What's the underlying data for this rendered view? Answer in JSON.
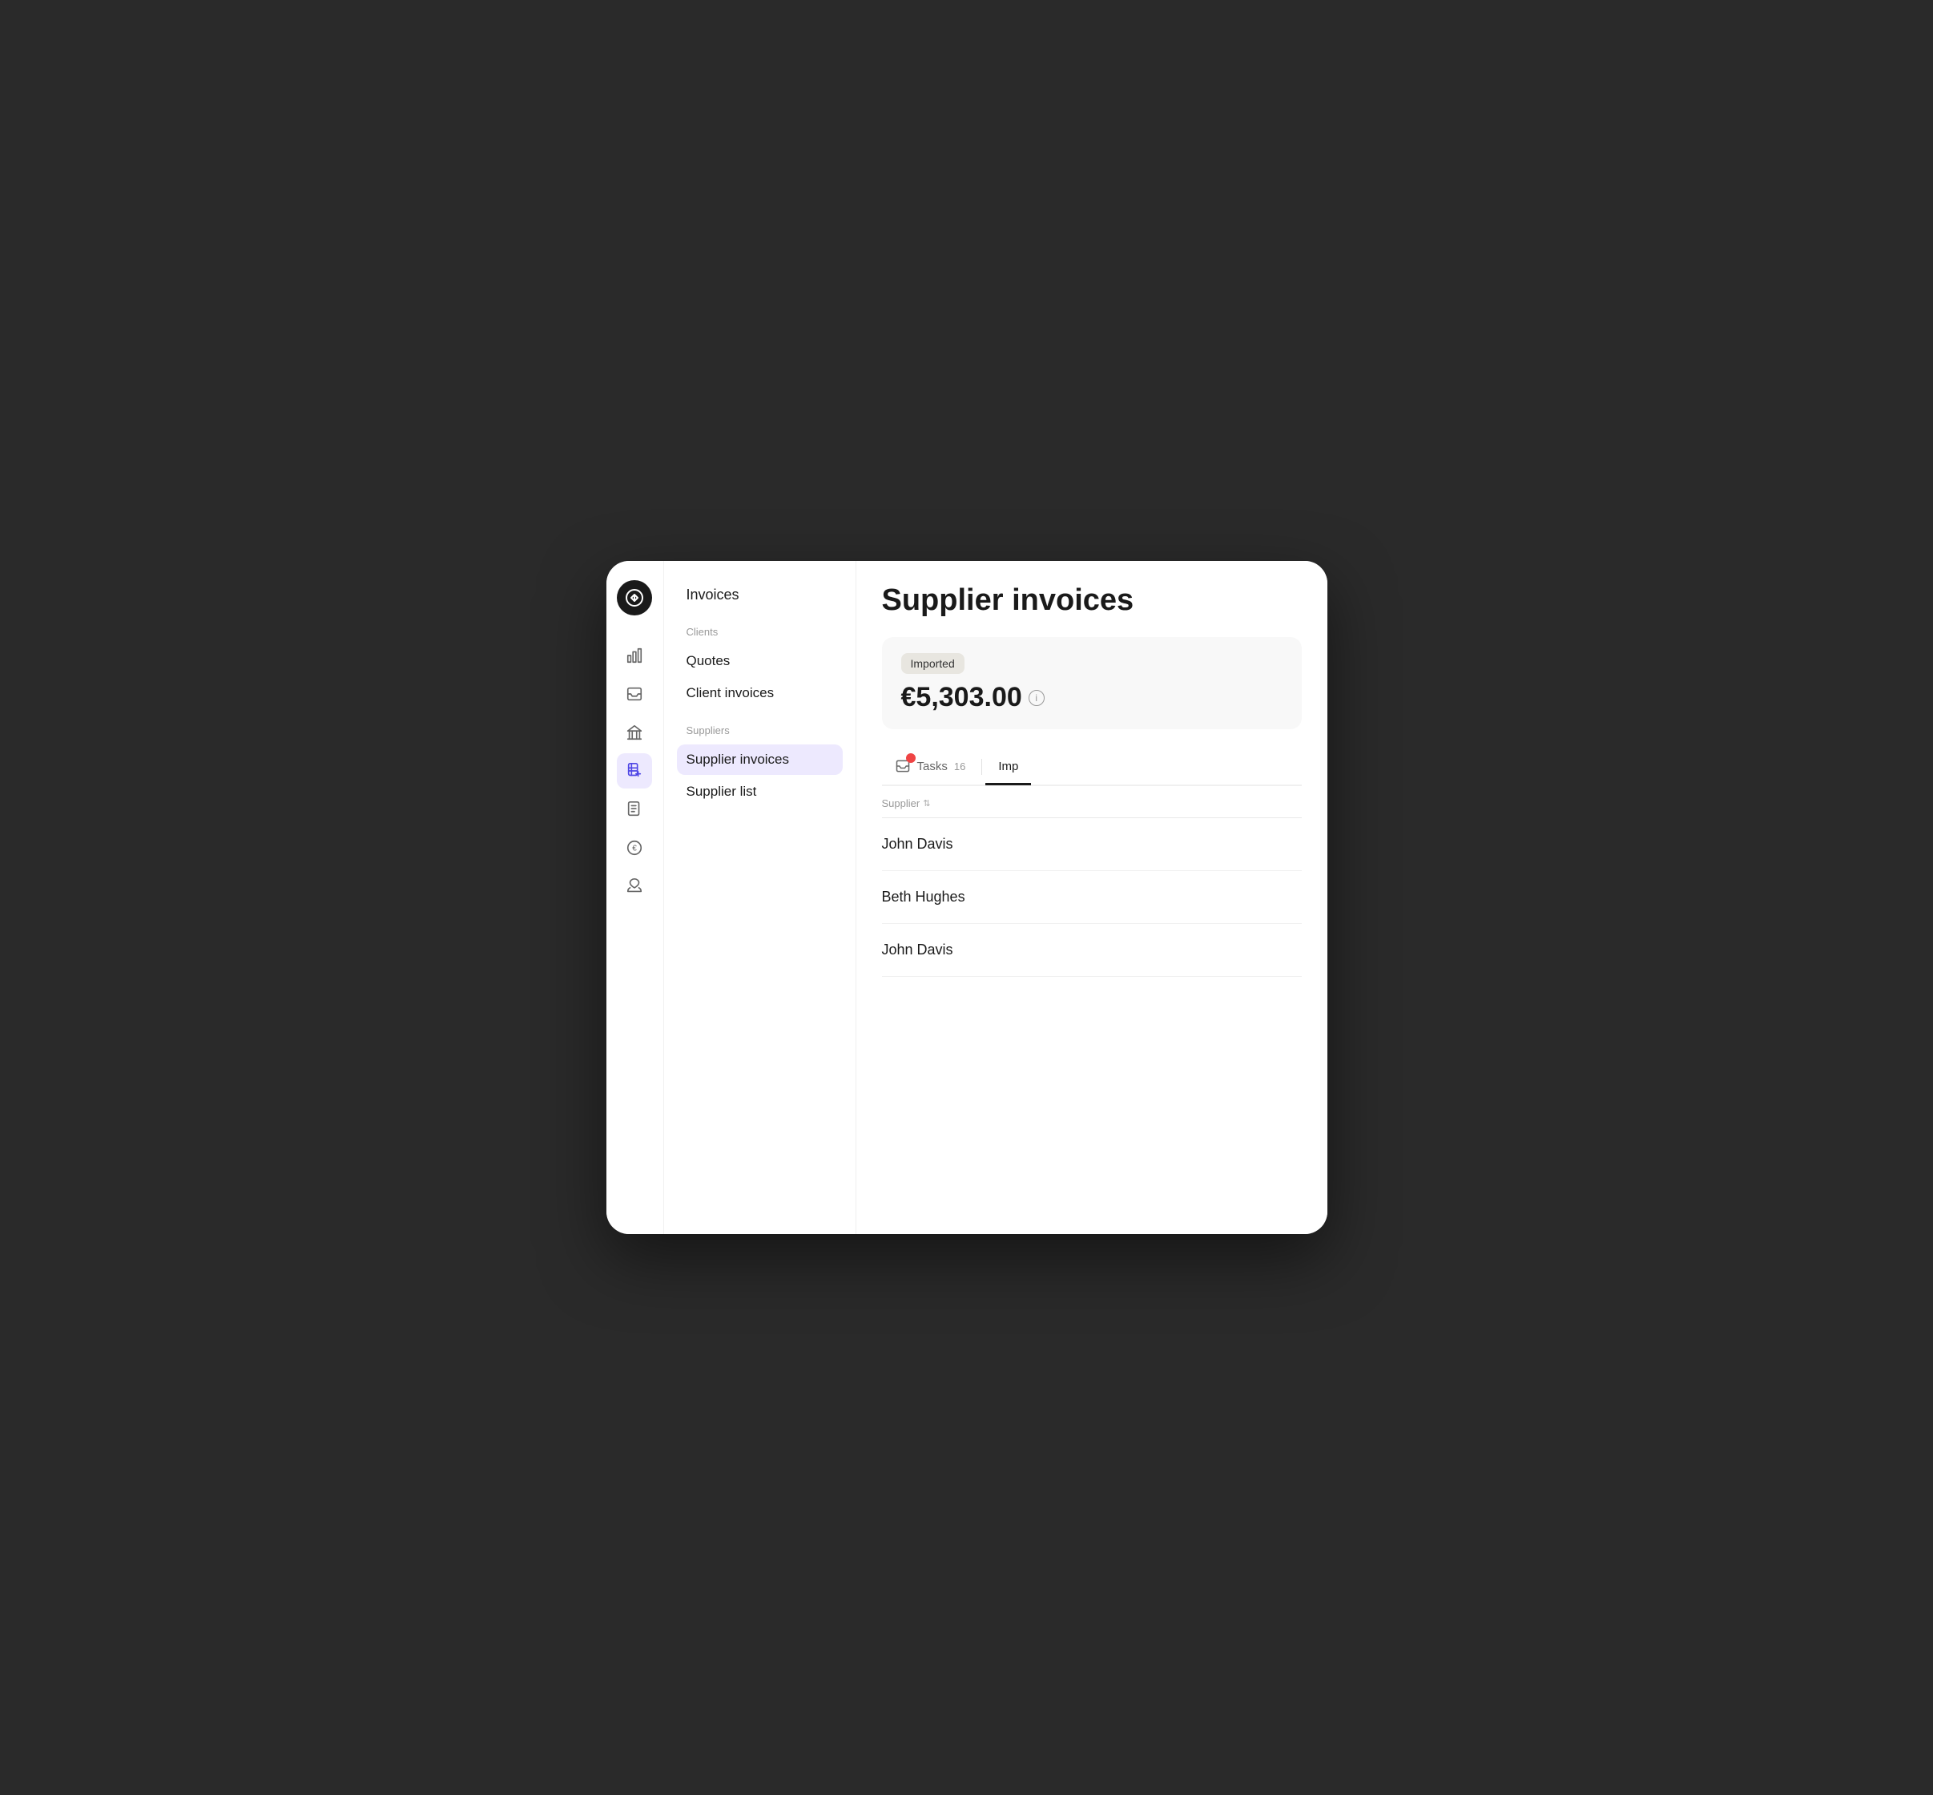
{
  "app": {
    "title": "Supplier invoices"
  },
  "logo": {
    "alt": "App logo"
  },
  "icon_nav": {
    "items": [
      {
        "name": "analytics-icon",
        "label": "Analytics"
      },
      {
        "name": "inbox-icon",
        "label": "Inbox"
      },
      {
        "name": "bank-icon",
        "label": "Bank"
      },
      {
        "name": "supplier-invoices-icon",
        "label": "Supplier Invoices",
        "active": true
      },
      {
        "name": "purchase-orders-icon",
        "label": "Purchase Orders"
      },
      {
        "name": "expenses-icon",
        "label": "Expenses"
      },
      {
        "name": "budget-icon",
        "label": "Budget"
      }
    ]
  },
  "sidebar": {
    "top_item": "Invoices",
    "sections": [
      {
        "label": "Clients",
        "items": [
          {
            "label": "Quotes",
            "active": false
          },
          {
            "label": "Client invoices",
            "active": false
          }
        ]
      },
      {
        "label": "Suppliers",
        "items": [
          {
            "label": "Supplier invoices",
            "active": true
          },
          {
            "label": "Supplier list",
            "active": false
          }
        ]
      }
    ]
  },
  "summary": {
    "badge": "Imported",
    "amount": "€5,303.00",
    "info_label": "i"
  },
  "tabs": [
    {
      "label": "Tasks",
      "count": "16",
      "has_badge": true,
      "active": false
    },
    {
      "label": "Imp",
      "count": "",
      "has_badge": false,
      "active": true
    }
  ],
  "table": {
    "columns": [
      {
        "label": "Supplier",
        "sortable": true
      }
    ],
    "rows": [
      {
        "supplier": "John Davis"
      },
      {
        "supplier": "Beth Hughes"
      },
      {
        "supplier": "John Davis"
      }
    ]
  }
}
